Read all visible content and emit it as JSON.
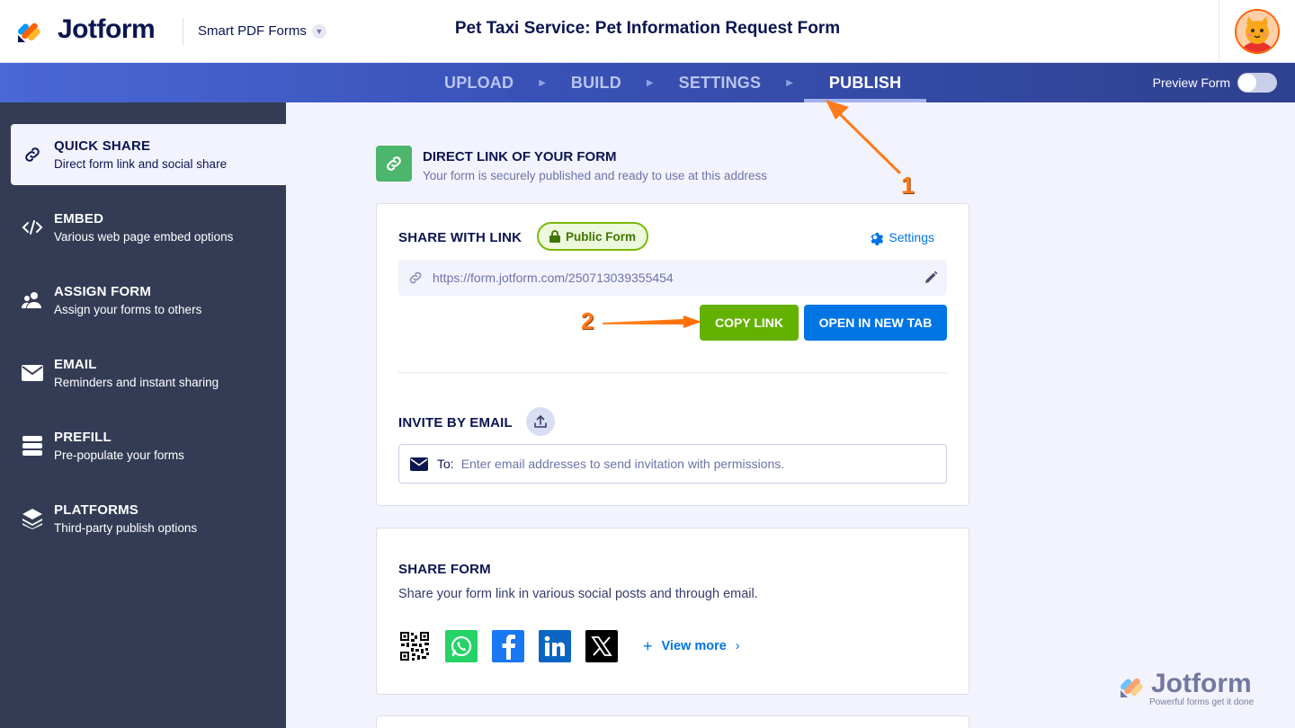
{
  "header": {
    "brand": "Jotform",
    "product": "Smart PDF Forms",
    "form_title": "Pet Taxi Service: Pet Information Request Form"
  },
  "nav": {
    "steps": [
      "UPLOAD",
      "BUILD",
      "SETTINGS",
      "PUBLISH"
    ],
    "active_step": "PUBLISH",
    "preview_label": "Preview Form",
    "preview_enabled": false
  },
  "sidebar": {
    "items": [
      {
        "title": "QUICK SHARE",
        "subtitle": "Direct form link and social share",
        "icon": "link-icon",
        "active": true
      },
      {
        "title": "EMBED",
        "subtitle": "Various web page embed options",
        "icon": "code-icon",
        "active": false
      },
      {
        "title": "ASSIGN FORM",
        "subtitle": "Assign your forms to others",
        "icon": "users-icon",
        "active": false
      },
      {
        "title": "EMAIL",
        "subtitle": "Reminders and instant sharing",
        "icon": "envelope-icon",
        "active": false
      },
      {
        "title": "PREFILL",
        "subtitle": "Pre-populate your forms",
        "icon": "database-icon",
        "active": false
      },
      {
        "title": "PLATFORMS",
        "subtitle": "Third-party publish options",
        "icon": "layers-icon",
        "active": false
      }
    ]
  },
  "direct_link": {
    "title": "DIRECT LINK OF YOUR FORM",
    "subtitle": "Your form is securely published and ready to use at this address"
  },
  "share_link": {
    "title": "SHARE WITH LINK",
    "badge": "Public Form",
    "settings_label": "Settings",
    "url": "https://form.jotform.com/250713039355454",
    "copy_label": "COPY LINK",
    "open_label": "OPEN IN NEW TAB"
  },
  "invite": {
    "title": "INVITE BY EMAIL",
    "to_label": "To:",
    "placeholder": "Enter email addresses to send invitation with permissions."
  },
  "share_form": {
    "title": "SHARE FORM",
    "description": "Share your form link in various social posts and through email.",
    "socials": [
      "qr-code-icon",
      "whatsapp-icon",
      "facebook-icon",
      "linkedin-icon",
      "x-icon"
    ],
    "view_more": "View more"
  },
  "watermark": {
    "brand": "Jotform",
    "tagline": "Powerful forms get it done"
  },
  "annotations": [
    "1",
    "2"
  ],
  "colors": {
    "brand_navy": "#0a1551",
    "sidebar_bg": "#343c55",
    "copy_green": "#64b200",
    "open_blue": "#0075e3",
    "annotation_orange": "#ff7a1a"
  }
}
